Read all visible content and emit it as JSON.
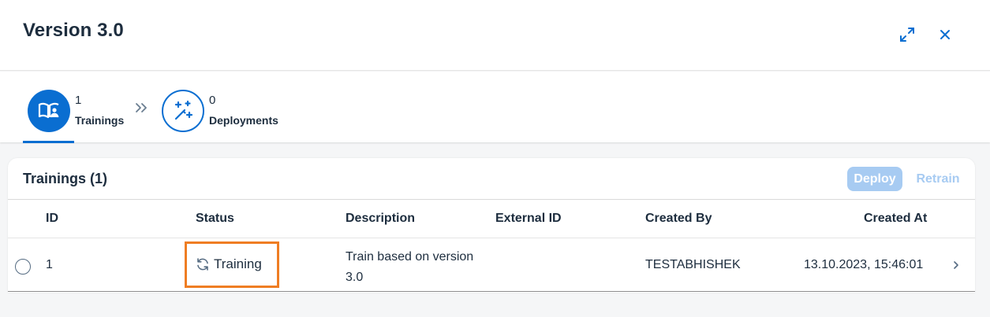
{
  "header": {
    "title": "Version 3.0",
    "fullscreen_icon": "fullscreen-icon",
    "close_icon": "close-icon"
  },
  "tabs": [
    {
      "icon": "book-person-icon",
      "count": "1",
      "label": "Trainings",
      "selected": true
    },
    {
      "icon": "magic-wand-icon",
      "count": "0",
      "label": "Deployments",
      "selected": false
    }
  ],
  "trainings": {
    "title": "Trainings (1)",
    "actions": {
      "deploy_label": "Deploy",
      "retrain_label": "Retrain"
    },
    "columns": [
      "ID",
      "Status",
      "Description",
      "External ID",
      "Created By",
      "Created At"
    ],
    "rows": [
      {
        "id": "1",
        "status": "Training",
        "description": "Train based on version 3.0",
        "external_id": "",
        "created_by": "TESTABHISHEK",
        "created_at": "13.10.2023, 15:46:01"
      }
    ]
  },
  "colors": {
    "accent": "#0a6ed1",
    "highlight": "#ef7d23",
    "disabled_button": "#a7cbf2"
  }
}
